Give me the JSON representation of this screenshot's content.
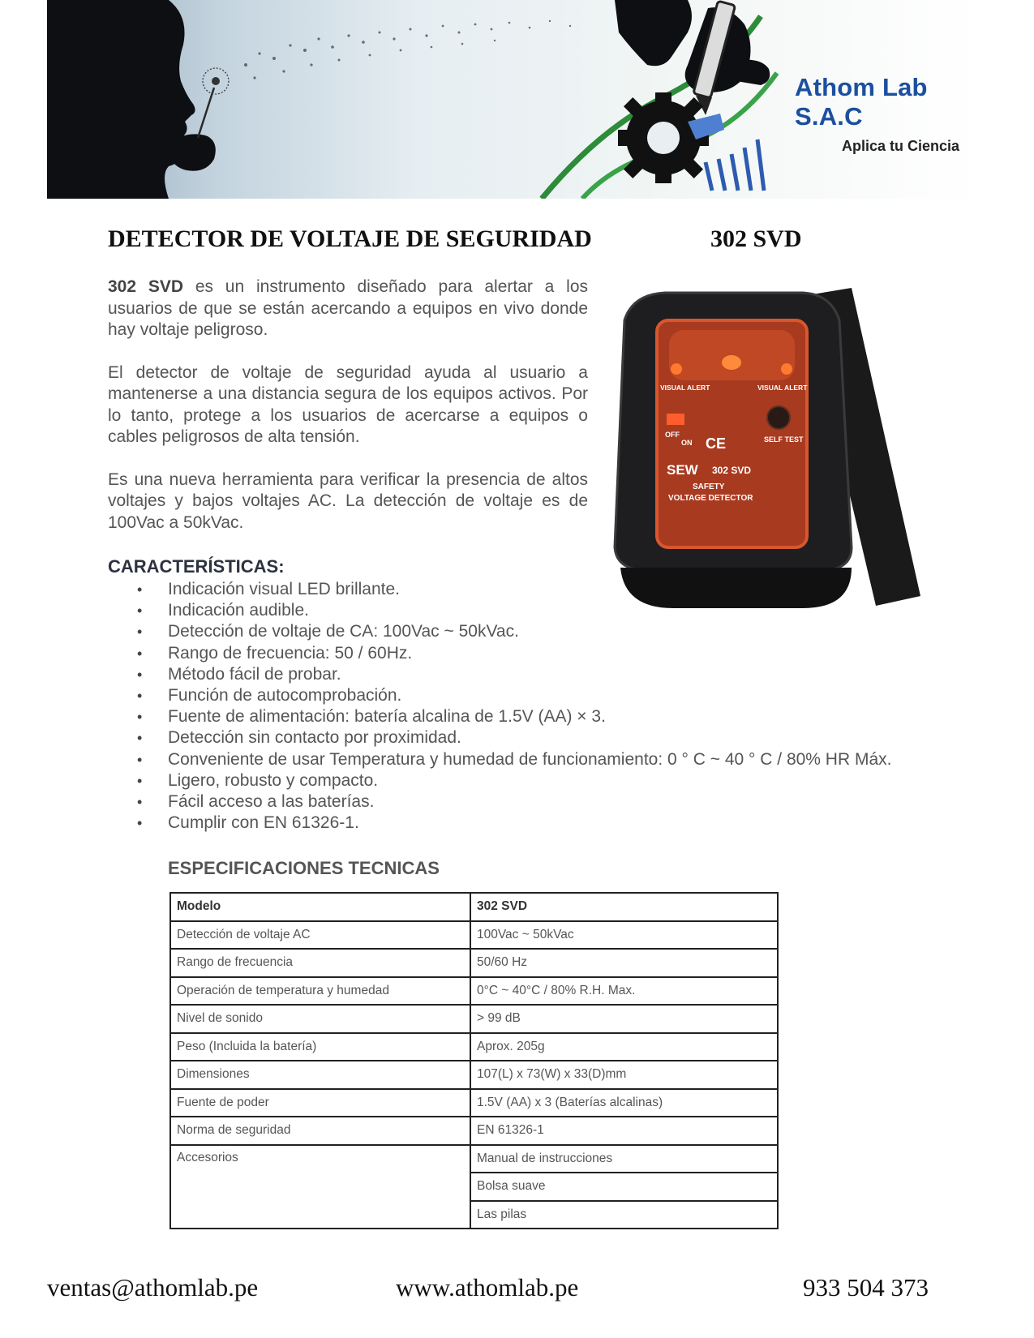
{
  "header": {
    "brand_name": "Athom Lab S.A.C",
    "brand_tagline": "Aplica tu Ciencia"
  },
  "title": "DETECTOR DE VOLTAJE DE SEGURIDAD",
  "title_model": "302 SVD",
  "intro": {
    "p1_bold": "302 SVD",
    "p1_rest": " es un instrumento diseñado para alertar a los usuarios de que se están acercando a equipos en vivo donde hay voltaje peligroso.",
    "p2": "El detector de voltaje de seguridad ayuda al usuario a mantenerse a una distancia segura de los equipos activos. Por lo tanto, protege a los usuarios de acercarse a equipos o cables peligrosos de alta tensión.",
    "p3": "Es una nueva herramienta para verificar la presencia de altos voltajes y bajos voltajes AC. La detección de voltaje es de 100Vac a 50kVac."
  },
  "product_image": {
    "labels": {
      "visual_alert_left": "VISUAL ALERT",
      "visual_alert_right": "VISUAL ALERT",
      "off": "OFF",
      "on": "ON",
      "ce": "CE",
      "self_test": "SELF TEST",
      "brand": "SEW",
      "model": "302 SVD",
      "line1": "SAFETY",
      "line2": "VOLTAGE DETECTOR"
    }
  },
  "features_heading": "CARACTERÍSTICAS:",
  "features": [
    "Indicación visual LED brillante.",
    "Indicación audible.",
    "Detección de voltaje de CA: 100Vac ~ 50kVac.",
    "Rango de frecuencia: 50 / 60Hz.",
    "Método fácil de probar.",
    "Función de autocomprobación.",
    "Fuente de alimentación: batería alcalina de 1.5V (AA) × 3.",
    "Detección sin contacto por proximidad.",
    "Conveniente de usar Temperatura y humedad de funcionamiento: 0 ° C ~ 40 ° C / 80% HR Máx.",
    "Ligero, robusto y compacto.",
    "Fácil acceso a las baterías.",
    "Cumplir con EN 61326-1."
  ],
  "specs_heading": "ESPECIFICACIONES TECNICAS",
  "specs": {
    "header": [
      "Modelo",
      "302 SVD"
    ],
    "rows": [
      [
        "Detección de voltaje AC",
        "100Vac ~ 50kVac"
      ],
      [
        "Rango de frecuencia",
        "50/60 Hz"
      ],
      [
        "Operación de temperatura y humedad",
        "0°C ~ 40°C / 80% R.H. Max."
      ],
      [
        "Nivel de sonido",
        "> 99 dB"
      ],
      [
        "Peso (Incluida la batería)",
        "Aprox. 205g"
      ],
      [
        "Dimensiones",
        "107(L) x 73(W) x 33(D)mm"
      ],
      [
        "Fuente de poder",
        "1.5V (AA) x 3 (Baterías alcalinas)"
      ],
      [
        "Norma de seguridad",
        "EN 61326-1"
      ]
    ],
    "accessories_label": "Accesorios",
    "accessories": [
      "Manual de instrucciones",
      "Bolsa suave",
      "Las pilas"
    ]
  },
  "footer": {
    "email": "ventas@athomlab.pe",
    "website": "www.athomlab.pe",
    "phone": "933 504 373"
  }
}
